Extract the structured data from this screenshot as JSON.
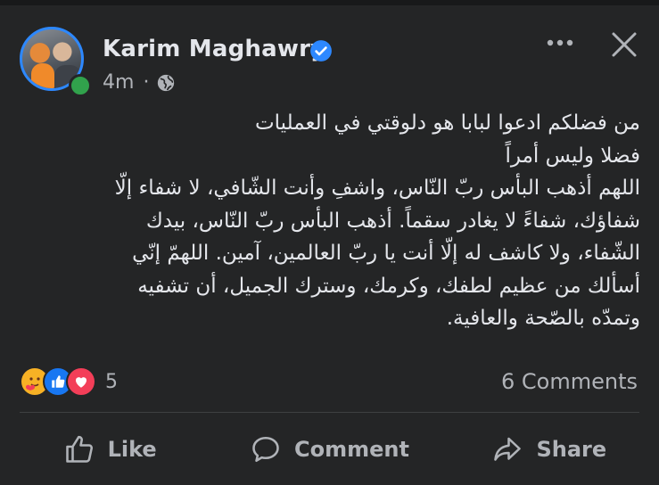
{
  "post": {
    "author": "Karim Maghawry",
    "time": "4m",
    "separator": "·",
    "text_lines": [
      "من فضلكم ادعوا لبابا هو دلوقتي في العمليات",
      "فضلا وليس أمراً",
      "اللهم أذهب البأس ربّ النّاس، واشفِ وأنت الشّافي، لا شفاء إلّا",
      "شفاؤك، شفاءً لا يغادر سقماً. أذهب البأس ربّ النّاس، بيدك",
      "الشّفاء، ولا كاشف له إلّا أنت يا ربّ العالمين، آمين. اللهمّ إنّي",
      "أسألك من عظيم لطفك، وكرمك، وسترك الجميل، أن تشفيه",
      "وتمدّه بالصّحة والعافية."
    ]
  },
  "reactions": {
    "icons": [
      "care-icon",
      "like-icon",
      "love-icon"
    ],
    "count": "5",
    "comments": "6 Comments"
  },
  "actions": {
    "like": "Like",
    "comment": "Comment",
    "share": "Share"
  },
  "colors": {
    "background": "#242526",
    "text": "#e4e6eb",
    "secondary_text": "#b0b3b8",
    "verified": "#2d88ff",
    "online": "#31a24c"
  }
}
